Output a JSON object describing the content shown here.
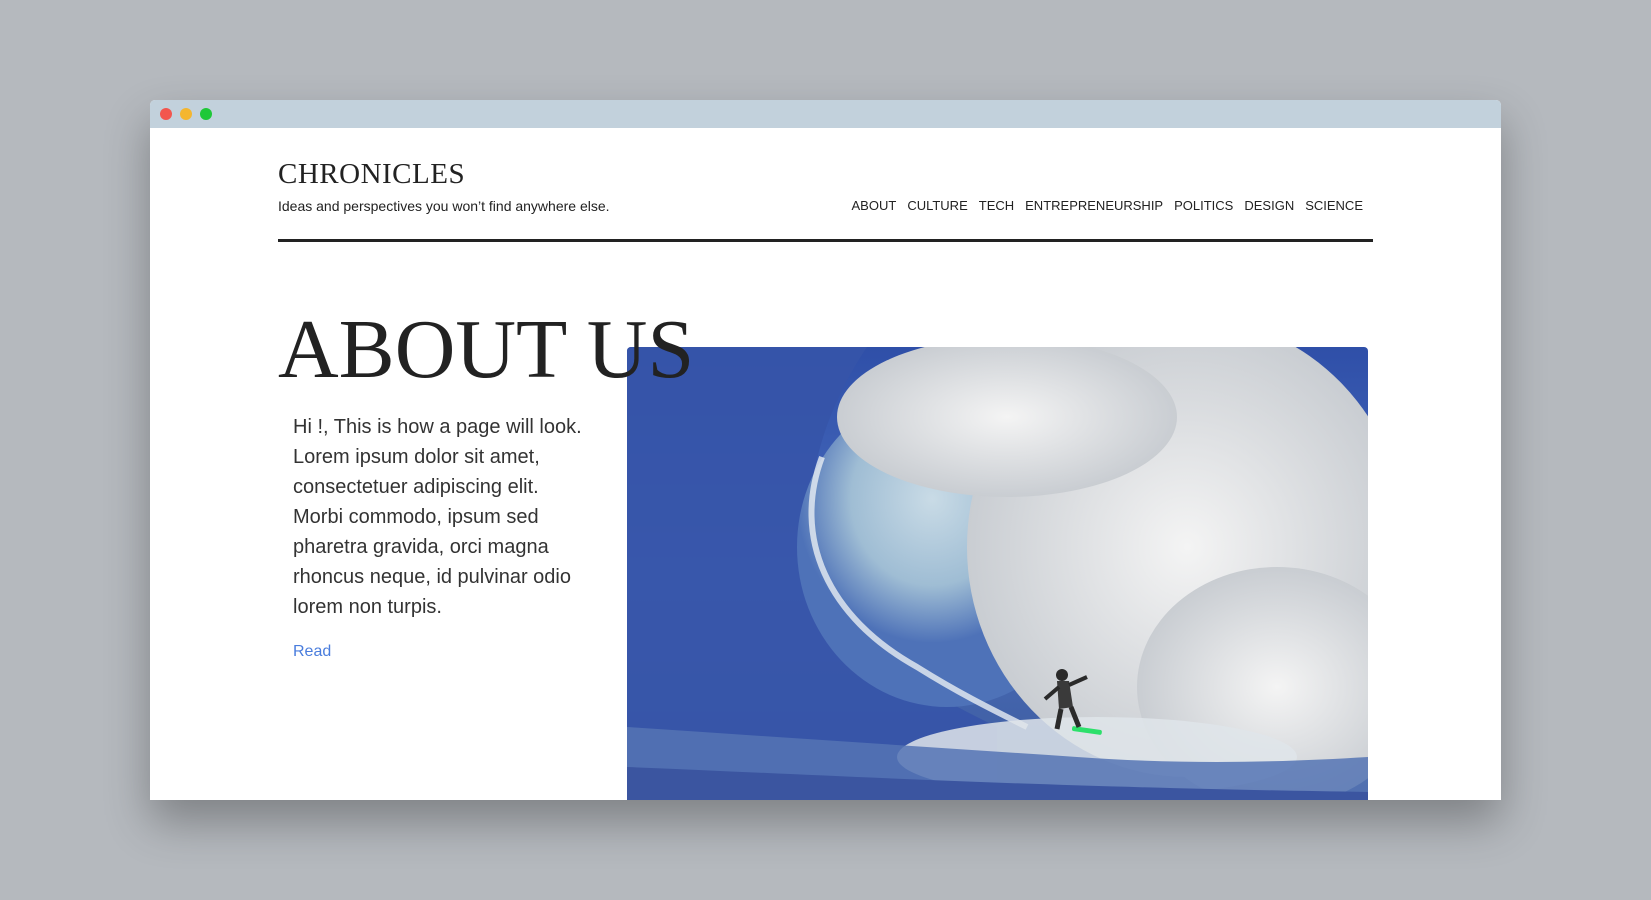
{
  "window": {
    "controls": [
      {
        "name": "close",
        "color": "#f2564e"
      },
      {
        "name": "minimize",
        "color": "#f4b62f"
      },
      {
        "name": "maximize",
        "color": "#1ec838"
      }
    ]
  },
  "header": {
    "brand": "CHRONICLES",
    "tagline": "Ideas and perspectives you won’t find anywhere else.",
    "nav": [
      "ABOUT",
      "CULTURE",
      "TECH",
      "ENTREPRENEURSHIP",
      "POLITICS",
      "DESIGN",
      "SCIENCE"
    ]
  },
  "main": {
    "title": "ABOUT US",
    "intro": "Hi !, This is how a page will look. Lorem ipsum dolor sit amet, consectetuer adipiscing elit. Morbi commodo, ipsum sed pharetra gravida, orci magna rhoncus neque, id pulvinar odio lorem non turpis.",
    "read_link": "Read",
    "image_icon": "surfer-wave-photo"
  },
  "colors": {
    "background": "#b5b9be",
    "titlebar": "#c2d1dc",
    "text": "#222222",
    "link": "#4a7ddd"
  }
}
